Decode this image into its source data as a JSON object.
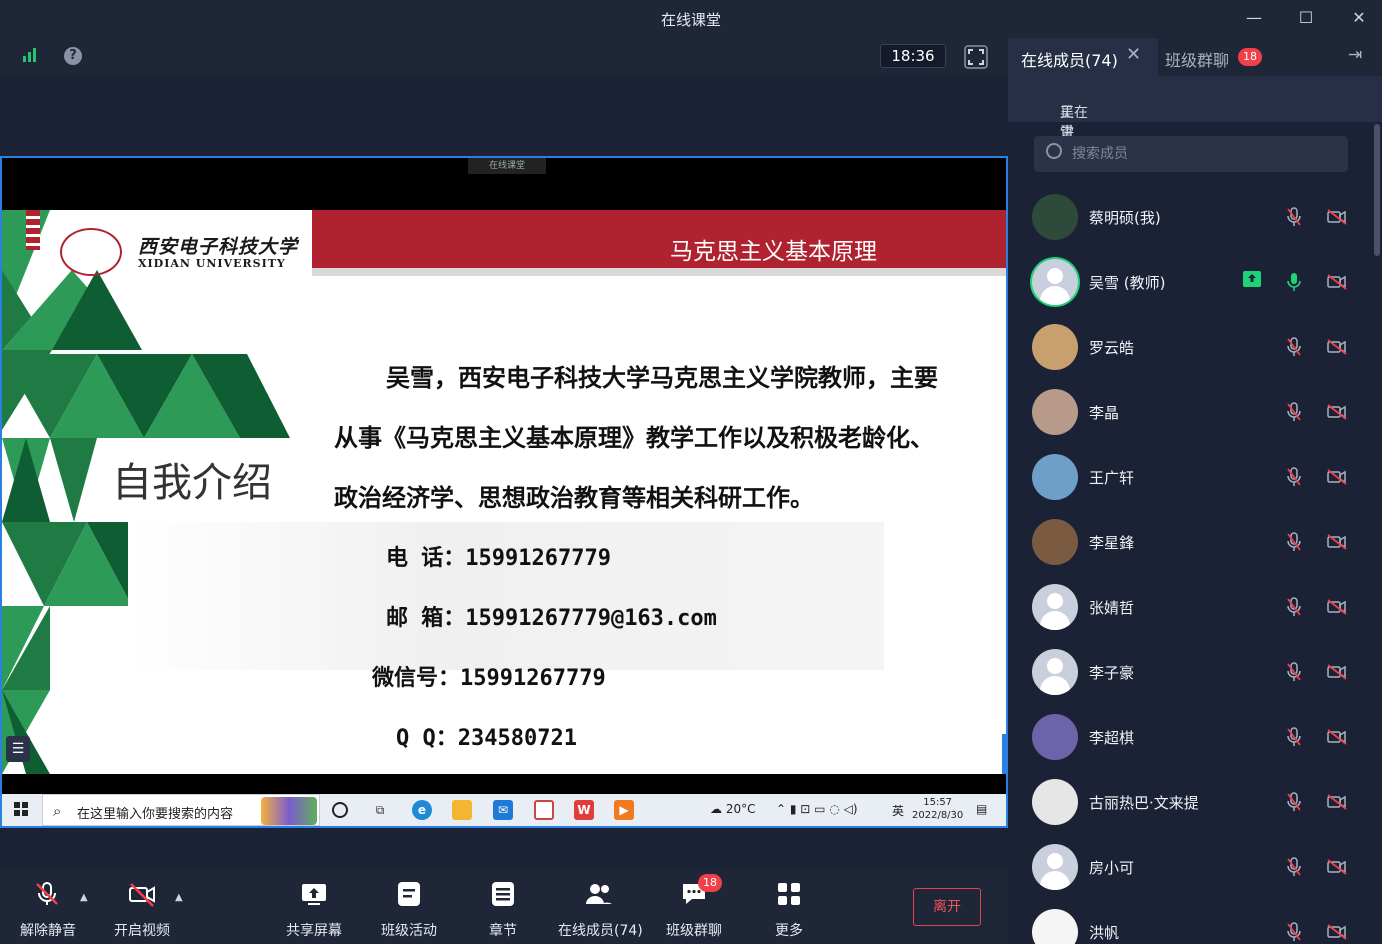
{
  "window": {
    "title": "在线课堂",
    "minimize": "—",
    "maximize": "☐",
    "close": "✕"
  },
  "topbar": {
    "help": "?",
    "clock": "18:36"
  },
  "slide": {
    "mini_tag": "在线课堂",
    "course_title": "马克思主义基本原理",
    "university_cn": "西安电子科技大学",
    "university_en": "XIDIAN UNIVERSITY",
    "intro_title": "自我介绍",
    "paragraph_lines": [
      "吴雪，西安电子科技大学马克思主义学院教师，主要",
      "从事《马克思主义基本原理》教学工作以及积极老龄化、",
      "政治经济学、思想政治教育等相关科研工作。"
    ],
    "contacts": [
      {
        "label": "电  话：",
        "value": "15991267779"
      },
      {
        "label": "邮  箱：",
        "value": "15991267779@163.com"
      },
      {
        "label": "微信号：",
        "value": "15991267779"
      },
      {
        "label": "Q Q：",
        "value": "234580721"
      }
    ],
    "side_button": "☰"
  },
  "taskbar": {
    "search_placeholder": "在这里输入你要搜索的内容",
    "weather": "20°C",
    "lang": "英",
    "time": "15:57",
    "date": "2022/8/30"
  },
  "toolbar": {
    "items": [
      {
        "label": "解除静音"
      },
      {
        "label": "开启视频"
      },
      {
        "label": "共享屏幕"
      },
      {
        "label": "班级活动"
      },
      {
        "label": "章节"
      },
      {
        "label": "在线成员(74)"
      },
      {
        "label": "班级群聊",
        "badge": "18"
      },
      {
        "label": "更多"
      }
    ],
    "leave": "离开"
  },
  "panel": {
    "tab_members": "在线成员(74)",
    "tab_chat": "班级群聊",
    "chat_badge": "18",
    "speaking_label": "正在讲话：",
    "speaking_name": "吴雪",
    "search_placeholder": "搜索成员",
    "members": [
      {
        "name": "蔡明硕(我)"
      },
      {
        "name": "吴雪 (教师)"
      },
      {
        "name": "罗云皓"
      },
      {
        "name": "李晶"
      },
      {
        "name": "王广轩"
      },
      {
        "name": "李星鋒"
      },
      {
        "name": "张婧哲"
      },
      {
        "name": "李子豪"
      },
      {
        "name": "李超棋"
      },
      {
        "name": "古丽热巴·文来提"
      },
      {
        "name": "房小可"
      },
      {
        "name": "洪帆"
      }
    ]
  }
}
